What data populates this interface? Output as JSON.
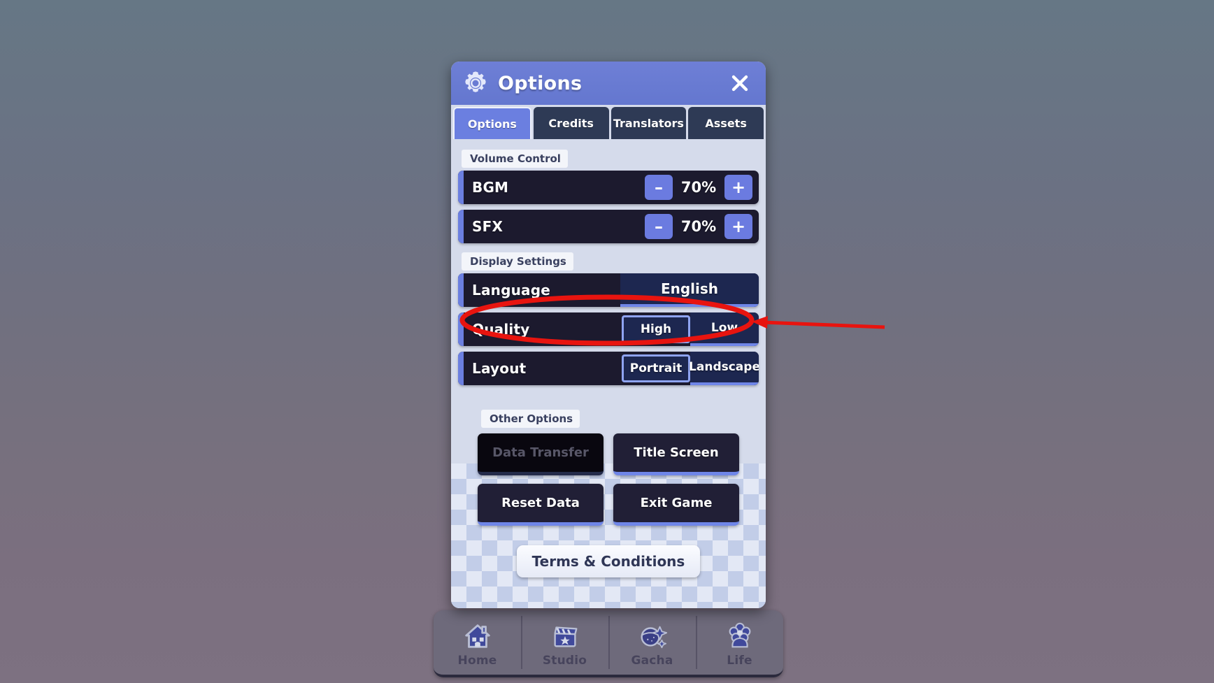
{
  "window": {
    "background_top_color": "#667785",
    "background_bottom_color": "#7d7181"
  },
  "modal": {
    "title": "Options",
    "gear_icon": "gear-icon",
    "close_icon": "close-icon",
    "accent_color": "#6b7fe0",
    "panel_background": "#d5dbeb",
    "tabs": [
      {
        "label": "Options",
        "active": true
      },
      {
        "label": "Credits",
        "active": false
      },
      {
        "label": "Translators",
        "active": false
      },
      {
        "label": "Assets",
        "active": false
      }
    ],
    "sections": {
      "volume": {
        "label": "Volume Control",
        "rows": [
          {
            "label": "BGM",
            "value": "70%",
            "minus": "–",
            "plus": "+"
          },
          {
            "label": "SFX",
            "value": "70%",
            "minus": "–",
            "plus": "+"
          }
        ]
      },
      "display": {
        "label": "Display Settings",
        "language": {
          "label": "Language",
          "value": "English"
        },
        "quality": {
          "label": "Quality",
          "options": [
            {
              "label": "High",
              "selected": true
            },
            {
              "label": "Low",
              "selected": false
            }
          ]
        },
        "layout": {
          "label": "Layout",
          "options": [
            {
              "label": "Portrait",
              "selected": true
            },
            {
              "label": "Landscape",
              "selected": false
            }
          ]
        }
      },
      "other": {
        "label": "Other Options",
        "buttons": [
          {
            "label": "Data Transfer",
            "disabled": true
          },
          {
            "label": "Title Screen",
            "disabled": false
          },
          {
            "label": "Reset Data",
            "disabled": false
          },
          {
            "label": "Exit Game",
            "disabled": false
          }
        ],
        "terms_label": "Terms & Conditions"
      }
    }
  },
  "bottom_nav": {
    "items": [
      {
        "label": "Home",
        "icon": "house-icon"
      },
      {
        "label": "Studio",
        "icon": "clapperboard-icon"
      },
      {
        "label": "Gacha",
        "icon": "gacha-ball-icon"
      },
      {
        "label": "Life",
        "icon": "flower-icon"
      }
    ]
  },
  "annotation": {
    "color": "#e8140f",
    "shape": "ellipse-highlight",
    "target": "Language",
    "arrow": "arrow-pointing-left"
  }
}
